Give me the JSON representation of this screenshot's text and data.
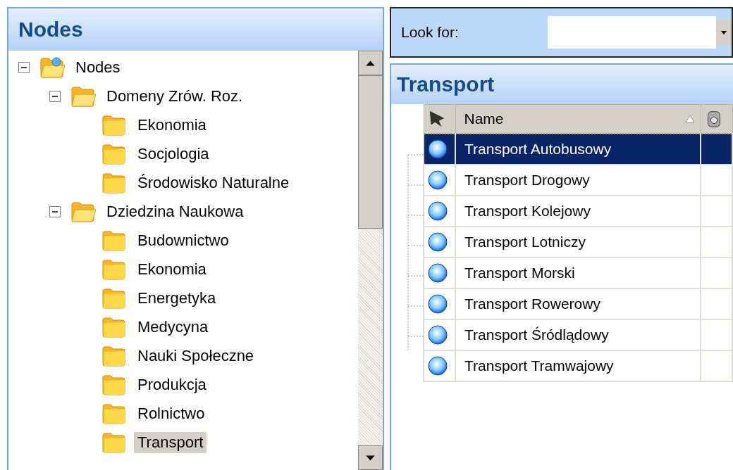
{
  "tree": {
    "title": "Nodes",
    "nodes": [
      {
        "label": "Nodes",
        "kind": "root",
        "expanded": true,
        "selected": false,
        "children": [
          {
            "label": "Domeny Zrów. Roz.",
            "expanded": true,
            "selected": false,
            "children": [
              {
                "label": "Ekonomia",
                "selected": false
              },
              {
                "label": "Socjologia",
                "selected": false
              },
              {
                "label": "Środowisko Naturalne",
                "selected": false
              }
            ]
          },
          {
            "label": "Dziedzina Naukowa",
            "expanded": true,
            "selected": false,
            "children": [
              {
                "label": "Budownictwo",
                "selected": false
              },
              {
                "label": "Ekonomia",
                "selected": false
              },
              {
                "label": "Energetyka",
                "selected": false
              },
              {
                "label": "Medycyna",
                "selected": false
              },
              {
                "label": "Nauki Społeczne",
                "selected": false
              },
              {
                "label": "Produkcja",
                "selected": false
              },
              {
                "label": "Rolnictwo",
                "selected": false
              },
              {
                "label": "Transport",
                "selected": true
              }
            ]
          }
        ]
      }
    ]
  },
  "search": {
    "label": "Look for:"
  },
  "list": {
    "title": "Transport",
    "columns": [
      {
        "kind": "icon"
      },
      {
        "label": "Name",
        "sorted": true
      },
      {
        "kind": "icon"
      }
    ],
    "rows": [
      {
        "name": "Transport Autobusowy",
        "selected": true
      },
      {
        "name": "Transport Drogowy",
        "selected": false
      },
      {
        "name": "Transport Kolejowy",
        "selected": false
      },
      {
        "name": "Transport Lotniczy",
        "selected": false
      },
      {
        "name": "Transport Morski",
        "selected": false
      },
      {
        "name": "Transport Rowerowy",
        "selected": false
      },
      {
        "name": "Transport Śródlądowy",
        "selected": false
      },
      {
        "name": "Transport Tramwajowy",
        "selected": false
      }
    ]
  }
}
